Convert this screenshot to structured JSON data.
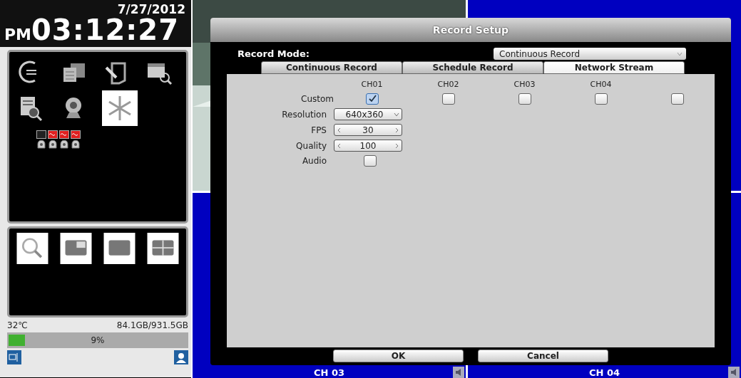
{
  "clock": {
    "ampm": "PM",
    "time": "03:12:27",
    "date": "7/27/2012"
  },
  "channel_status": [
    {
      "video_loss": false
    },
    {
      "video_loss": true
    },
    {
      "video_loss": true
    },
    {
      "video_loss": true
    }
  ],
  "status": {
    "temperature": "32℃",
    "storage": "84.1GB/931.5GB",
    "level": 0.09,
    "percent": "9%"
  },
  "cameras": [
    {
      "kind": "picture"
    },
    {
      "kind": "blank"
    },
    {
      "kind": "blank",
      "label": "CH 03"
    },
    {
      "kind": "blank",
      "label": "CH 04"
    }
  ],
  "dialog": {
    "title": "Record Setup",
    "record_mode_label": "Record Mode:",
    "record_mode": "Continuous Record",
    "tabs": [
      {
        "label": "Continuous Record",
        "selected": false
      },
      {
        "label": "Schedule Record",
        "selected": false
      },
      {
        "label": "Network Stream",
        "selected": true
      }
    ],
    "columns": [
      "CH01",
      "CH02",
      "CH03",
      "CH04"
    ],
    "custom_label": "Custom",
    "custom": [
      {
        "checked": true
      },
      {
        "checked": false
      },
      {
        "checked": false
      },
      {
        "checked": false
      },
      {
        "checked": false
      }
    ],
    "resolution_label": "Resolution",
    "resolution": "640x360",
    "fps_label": "FPS",
    "fps": "30",
    "quality_label": "Quality",
    "quality": "100",
    "audio_label": "Audio",
    "audio": {
      "checked": false
    },
    "buttons": [
      "OK",
      "Cancel"
    ]
  }
}
